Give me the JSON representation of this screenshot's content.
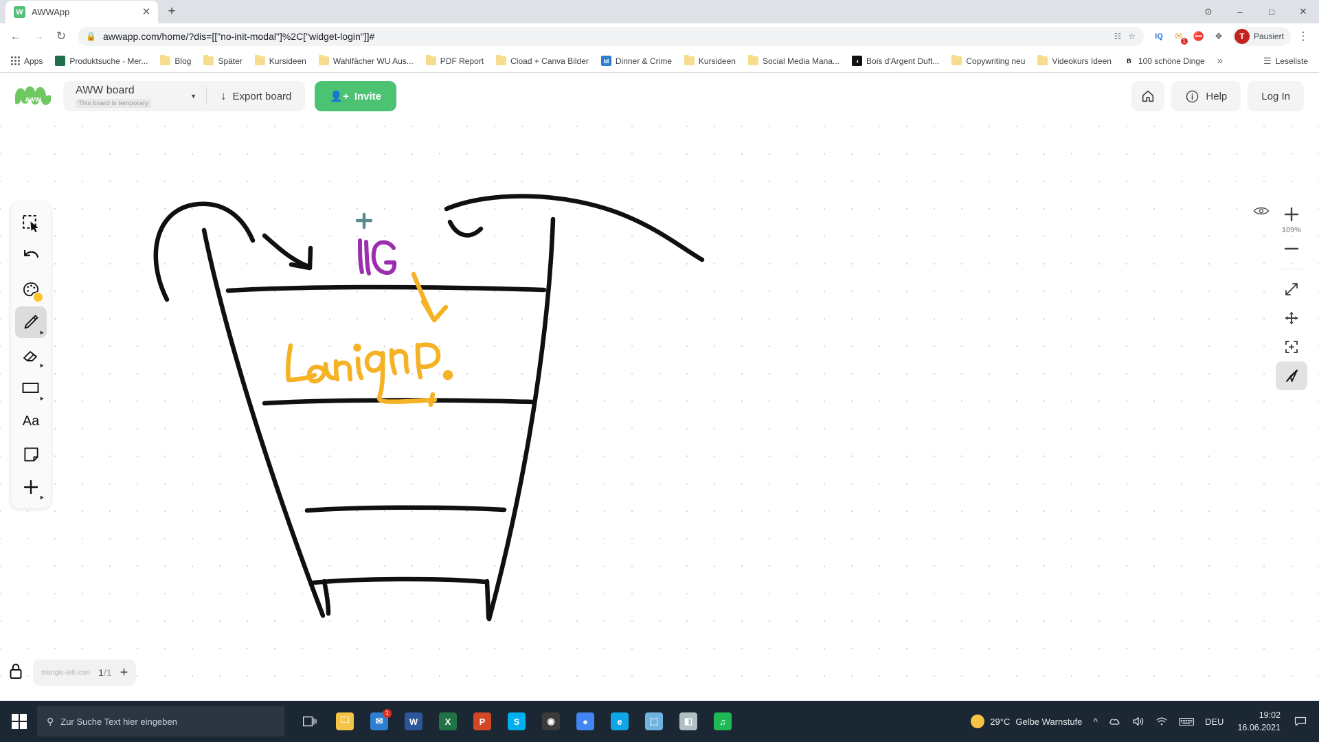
{
  "browser": {
    "tab": {
      "title": "AWWApp",
      "favicon_letter": "W",
      "favicon_color": "#53c07a",
      "close_icon": "close-icon"
    },
    "new_tab_label": "+",
    "window_controls": {
      "minimize": "–",
      "maximize": "□",
      "close": "✕",
      "extension": "⊙"
    },
    "nav": {
      "back": "←",
      "forward": "→",
      "reload": "↻"
    },
    "omnibox": {
      "lock_icon": "lock-icon",
      "url": "awwapp.com/home/?dis=[[\"no-init-modal\"]%2C[\"widget-login\"]]#",
      "translate_icon": "translate-icon",
      "star_icon": "star-icon"
    },
    "extensions": [
      {
        "name": "translate-extension",
        "glyph": "文",
        "color": "#5f6368"
      },
      {
        "name": "iq-extension",
        "glyph": "IQ",
        "color": "#3c4043"
      },
      {
        "name": "mail-extension",
        "glyph": "✉",
        "color": "#e8a33d",
        "badge": "1"
      },
      {
        "name": "adblock-extension",
        "glyph": "⛔",
        "color": "#d93025"
      },
      {
        "name": "puzzle-extension",
        "glyph": "❖",
        "color": "#5f6368"
      }
    ],
    "profile": {
      "initial": "T",
      "label": "Pausiert"
    },
    "menu_icon": "⋮",
    "bookmarks": [
      {
        "label": "Apps",
        "icon": "apps-grid-icon"
      },
      {
        "label": "Produktsuche - Mer...",
        "icon": "site-favicon",
        "color": "#1f6f4a"
      },
      {
        "label": "Blog",
        "icon": "folder-icon"
      },
      {
        "label": "Später",
        "icon": "folder-icon"
      },
      {
        "label": "Kursideen",
        "icon": "folder-icon"
      },
      {
        "label": "Wahlfächer WU Aus...",
        "icon": "folder-icon"
      },
      {
        "label": "PDF Report",
        "icon": "folder-icon"
      },
      {
        "label": "Cload + Canva Bilder",
        "icon": "folder-icon"
      },
      {
        "label": "Dinner & Crime",
        "icon": "site-favicon",
        "color": "#2f7fd1",
        "glyph": "id"
      },
      {
        "label": "Kursideen",
        "icon": "folder-icon"
      },
      {
        "label": "Social Media Mana...",
        "icon": "folder-icon"
      },
      {
        "label": "Bois d'Argent Duft...",
        "icon": "site-favicon",
        "color": "#111111",
        "glyph": "◑"
      },
      {
        "label": "Copywriting neu",
        "icon": "folder-icon"
      },
      {
        "label": "Videokurs Ideen",
        "icon": "folder-icon"
      },
      {
        "label": "100 schöne Dinge",
        "icon": "site-favicon",
        "color": "#ffffff",
        "glyph": "B"
      }
    ],
    "bookmarks_overflow": "»",
    "reading_list": {
      "label": "Leseliste",
      "icon": "reading-list-icon"
    }
  },
  "app": {
    "logo_text": "AWW",
    "board": {
      "name": "AWW board",
      "temporary_badge": "This board is temporary",
      "dropdown_icon": "chevron-down-icon"
    },
    "export_button": {
      "label": "Export board",
      "icon": "download-icon"
    },
    "invite_button": {
      "label": "Invite",
      "icon": "add-person-icon",
      "color": "#4cc273"
    },
    "header_right": {
      "home": {
        "icon": "home-icon"
      },
      "help": {
        "label": "Help",
        "icon": "info-icon"
      },
      "login": {
        "label": "Log In"
      }
    },
    "tools": [
      {
        "name": "select-tool",
        "icon": "selection-cursor-icon",
        "active": false,
        "has_submenu": false
      },
      {
        "name": "undo-tool",
        "icon": "undo-arrow-icon",
        "active": false,
        "has_submenu": false
      },
      {
        "name": "color-tool",
        "icon": "palette-icon",
        "active": false,
        "has_submenu": false,
        "swatch": "#fcc52a"
      },
      {
        "name": "pen-tool",
        "icon": "pencil-icon",
        "active": true,
        "has_submenu": true
      },
      {
        "name": "eraser-tool",
        "icon": "eraser-icon",
        "active": false,
        "has_submenu": true
      },
      {
        "name": "shape-tool",
        "icon": "rectangle-icon",
        "active": false,
        "has_submenu": true
      },
      {
        "name": "text-tool",
        "icon": "text-aa-icon",
        "active": false,
        "has_submenu": false,
        "label": "Aa"
      },
      {
        "name": "note-tool",
        "icon": "sticky-note-icon",
        "active": false,
        "has_submenu": false
      },
      {
        "name": "add-tool",
        "icon": "plus-icon",
        "active": false,
        "has_submenu": true
      }
    ],
    "right_tools": {
      "visibility_icon": "eye-icon",
      "zoom_in_icon": "plus-icon",
      "zoom_level": "109%",
      "zoom_out_icon": "minus-icon",
      "fit_icon": "expand-diagonal-icon",
      "pan_icon": "move-cross-icon",
      "center_icon": "center-target-icon",
      "navigate_icon": "navigate-cursor-icon",
      "navigate_active": true
    },
    "pages": {
      "lock_icon": "lock-icon",
      "prev_icon": "triangle-left-icon",
      "current": "1",
      "separator": "/",
      "total": "1",
      "add_icon": "plus-icon"
    },
    "drawing": {
      "description": "hand-drawn marketing funnel sketch",
      "texts": [
        {
          "value": "LG",
          "color": "#9b2fae"
        },
        {
          "value": "Landing P.",
          "color": "#f5b225"
        }
      ],
      "marker_plus": {
        "color": "#5d8a8f"
      }
    }
  },
  "taskbar": {
    "start_icon": "windows-start-icon",
    "search_placeholder": "Zur Suche Text hier eingeben",
    "search_icon": "search-icon",
    "task_view_icon": "task-view-icon",
    "apps": [
      {
        "name": "file-explorer",
        "glyph": "🗀",
        "color": "#f6c445"
      },
      {
        "name": "mail-app",
        "glyph": "✉",
        "color": "#2f7fd1",
        "badge": "1"
      },
      {
        "name": "word-app",
        "glyph": "W",
        "color": "#2b579a"
      },
      {
        "name": "excel-app",
        "glyph": "X",
        "color": "#217346"
      },
      {
        "name": "powerpoint-app",
        "glyph": "P",
        "color": "#d24726"
      },
      {
        "name": "skype-app",
        "glyph": "S",
        "color": "#00aff0"
      },
      {
        "name": "disc-app",
        "glyph": "◉",
        "color": "#3b3b3b"
      },
      {
        "name": "chrome-app",
        "glyph": "●",
        "color": "#4285f4"
      },
      {
        "name": "edge-app",
        "glyph": "e",
        "color": "#0ea5e9"
      },
      {
        "name": "photos-app",
        "glyph": "⬚",
        "color": "#6fb3e0"
      },
      {
        "name": "paint-app",
        "glyph": "◧",
        "color": "#b0bec5"
      },
      {
        "name": "spotify-app",
        "glyph": "♫",
        "color": "#1db954"
      }
    ],
    "weather": {
      "temperature": "29°C",
      "condition": "Gelbe Warnstufe",
      "icon": "sun-icon"
    },
    "tray": {
      "chevron": "˄",
      "onedrive_icon": "cloud-icon",
      "volume_icon": "speaker-icon",
      "wifi_icon": "wifi-icon",
      "keyboard_icon": "keyboard-icon",
      "language": "DEU"
    },
    "clock": {
      "time": "19:02",
      "date": "16.06.2021"
    },
    "notifications_icon": "notification-icon"
  }
}
